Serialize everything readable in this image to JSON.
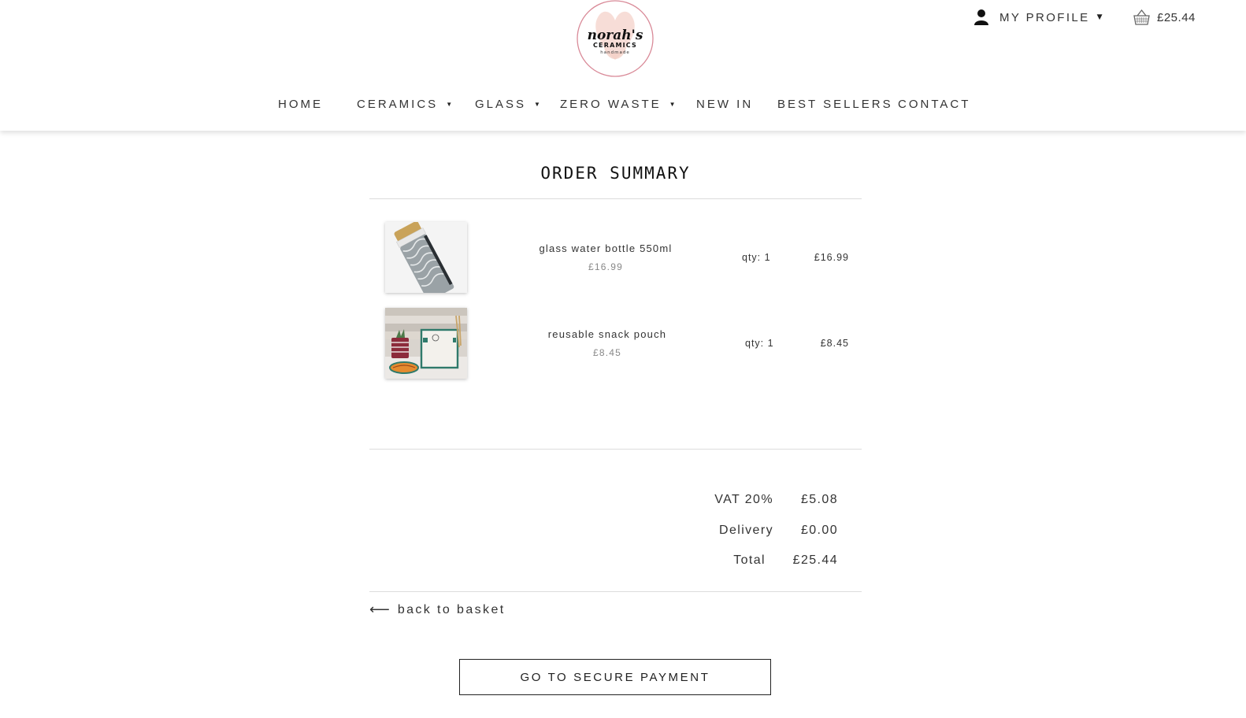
{
  "brand": {
    "name_line1": "norah's",
    "name_line2": "CERAMICS",
    "name_line3": "handmade",
    "accent": "#e8a7b0"
  },
  "header": {
    "profile_label": "MY PROFILE",
    "profile_icon": "user-icon",
    "basket_icon": "basket-icon",
    "basket_total": "£25.44"
  },
  "nav": {
    "items": [
      {
        "label": "HOME",
        "has_dropdown": false
      },
      {
        "label": "CERAMICS",
        "has_dropdown": true
      },
      {
        "label": "GLASS",
        "has_dropdown": true
      },
      {
        "label": "ZERO WASTE",
        "has_dropdown": true
      },
      {
        "label": "NEW IN",
        "has_dropdown": false
      },
      {
        "label": "BEST SELLERS",
        "has_dropdown": false
      },
      {
        "label": "CONTACT",
        "has_dropdown": false
      }
    ]
  },
  "order": {
    "title": "ORDER SUMMARY",
    "items": [
      {
        "name": "glass water bottle 550ml",
        "price": "£16.99",
        "qty": "qty: 1",
        "line_total": "£16.99"
      },
      {
        "name": "reusable snack pouch",
        "price": "£8.45",
        "qty": "qty: 1",
        "line_total": "£8.45"
      }
    ],
    "summary": [
      {
        "label": "VAT 20%",
        "value": "£5.08"
      },
      {
        "label": "Delivery",
        "value": "£0.00"
      },
      {
        "label": "Total",
        "value": "£25.44"
      }
    ],
    "back_label": "back to basket",
    "pay_label": "GO TO SECURE PAYMENT"
  }
}
